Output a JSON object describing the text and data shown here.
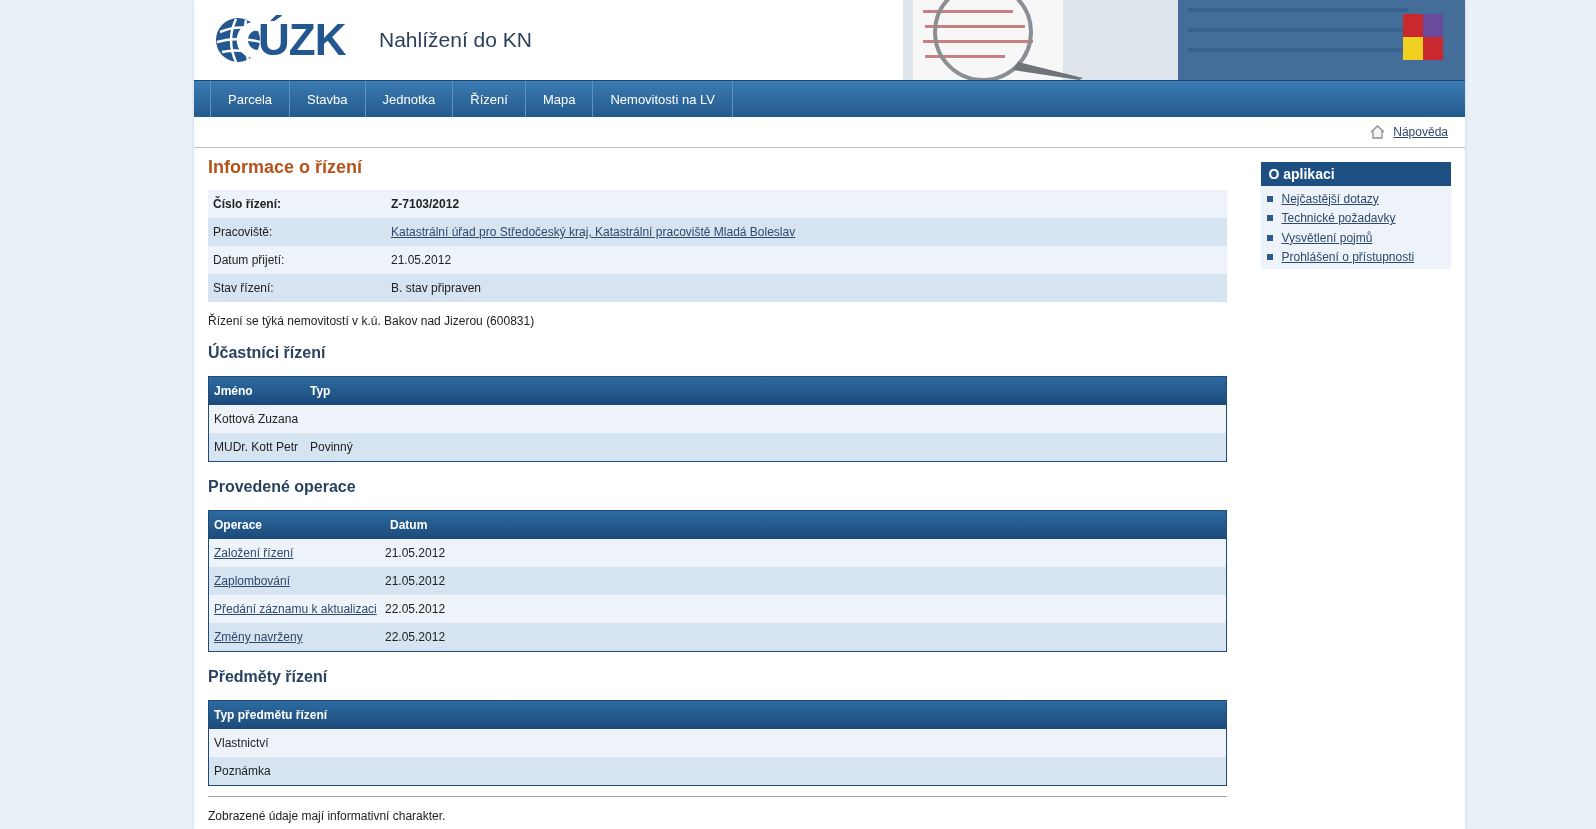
{
  "header": {
    "logo_text": "ÚZK",
    "app_title": "Nahlížení do KN"
  },
  "nav": [
    {
      "label": "Parcela",
      "selected": false
    },
    {
      "label": "Stavba",
      "selected": false
    },
    {
      "label": "Jednotka",
      "selected": false
    },
    {
      "label": "Řízení",
      "selected": false
    },
    {
      "label": "Mapa",
      "selected": false
    },
    {
      "label": "Nemovitosti na LV",
      "selected": false
    }
  ],
  "help_link": "Nápověda",
  "page_title": "Informace o řízení",
  "info": [
    {
      "label": "Číslo řízení:",
      "value": "Z-7103/2012",
      "kind": "bold"
    },
    {
      "label": "Pracoviště:",
      "value": "Katastrální úřad pro Středočeský kraj, Katastrální pracoviště Mladá Boleslav",
      "kind": "link"
    },
    {
      "label": "Datum přijetí:",
      "value": "21.05.2012",
      "kind": "text"
    },
    {
      "label": "Stav řízení:",
      "value": "B. stav připraven",
      "kind": "text"
    }
  ],
  "note": "Řízení se týká nemovitostí v k.ú. Bakov nad Jizerou (600831)",
  "sections": [
    {
      "title": "Účastníci řízení",
      "columns": [
        "Jméno",
        "Typ"
      ],
      "rows": [
        [
          "Kottová Zuzana",
          ""
        ],
        [
          "MUDr. Kott Petr",
          "Povinný"
        ]
      ],
      "link_column": false
    },
    {
      "title": "Provedené operace",
      "columns": [
        "Operace",
        "Datum"
      ],
      "rows": [
        [
          "Založení řízení",
          "21.05.2012"
        ],
        [
          "Zaplombování",
          "21.05.2012"
        ],
        [
          "Předání záznamu k aktualizaci",
          "22.05.2012"
        ],
        [
          "Změny navrženy",
          "22.05.2012"
        ]
      ],
      "link_column": true
    },
    {
      "title": "Předměty řízení",
      "columns": [
        "Typ předmětu řízení"
      ],
      "rows": [
        [
          "Vlastnictví"
        ],
        [
          "Poznámka"
        ]
      ],
      "link_column": false
    }
  ],
  "footer_note": "Zobrazené údaje mají informativní charakter.",
  "sidebar": {
    "title": "O aplikaci",
    "links": [
      "Nejčastější dotazy",
      "Technické požadavky",
      "Vysvětlení pojmů",
      "Prohlášení o přístupnosti"
    ]
  }
}
